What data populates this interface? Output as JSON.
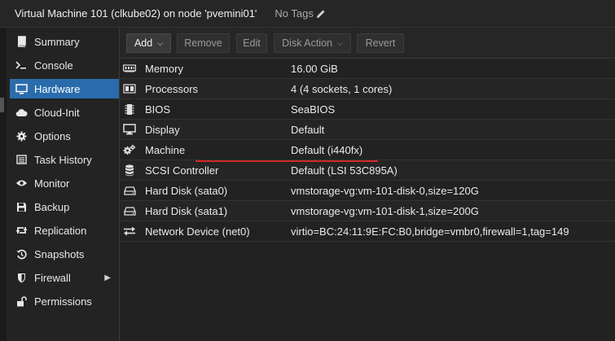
{
  "header": {
    "title": "Virtual Machine 101 (clkube02) on node 'pvemini01'",
    "tags_label": "No Tags",
    "edit_icon": "pencil-icon"
  },
  "sidebar": {
    "items": [
      {
        "label": "Summary",
        "icon": "book-icon"
      },
      {
        "label": "Console",
        "icon": "terminal-icon"
      },
      {
        "label": "Hardware",
        "icon": "monitor-icon",
        "active": true
      },
      {
        "label": "Cloud-Init",
        "icon": "cloud-icon"
      },
      {
        "label": "Options",
        "icon": "gear-icon"
      },
      {
        "label": "Task History",
        "icon": "list-icon"
      },
      {
        "label": "Monitor",
        "icon": "eye-icon"
      },
      {
        "label": "Backup",
        "icon": "floppy-icon"
      },
      {
        "label": "Replication",
        "icon": "retweet-icon"
      },
      {
        "label": "Snapshots",
        "icon": "history-icon"
      },
      {
        "label": "Firewall",
        "icon": "shield-icon"
      },
      {
        "label": "Permissions",
        "icon": "unlock-icon"
      }
    ]
  },
  "toolbar": {
    "add": "Add",
    "remove": "Remove",
    "edit": "Edit",
    "disk_action": "Disk Action",
    "revert": "Revert"
  },
  "hardware": {
    "rows": [
      {
        "key": "Memory",
        "value": "16.00 GiB",
        "icon": "memory-icon"
      },
      {
        "key": "Processors",
        "value": "4 (4 sockets, 1 cores)",
        "icon": "cpu-icon"
      },
      {
        "key": "BIOS",
        "value": "SeaBIOS",
        "icon": "chip-icon"
      },
      {
        "key": "Display",
        "value": "Default",
        "icon": "desktop-icon"
      },
      {
        "key": "Machine",
        "value": "Default (i440fx)",
        "icon": "cogs-icon"
      },
      {
        "key": "SCSI Controller",
        "value": "Default (LSI 53C895A)",
        "icon": "database-icon"
      },
      {
        "key": "Hard Disk (sata0)",
        "value": "vmstorage-vg:vm-101-disk-0,size=120G",
        "icon": "hdd-icon"
      },
      {
        "key": "Hard Disk (sata1)",
        "value": "vmstorage-vg:vm-101-disk-1,size=200G",
        "icon": "hdd-icon"
      },
      {
        "key": "Network Device (net0)",
        "value": "virtio=BC:24:11:9E:FC:B0,bridge=vmbr0,firewall=1,tag=149",
        "icon": "exchange-icon"
      }
    ]
  },
  "colors": {
    "accent": "#2a6cab",
    "annotation": "#d42626",
    "background": "#222222"
  }
}
